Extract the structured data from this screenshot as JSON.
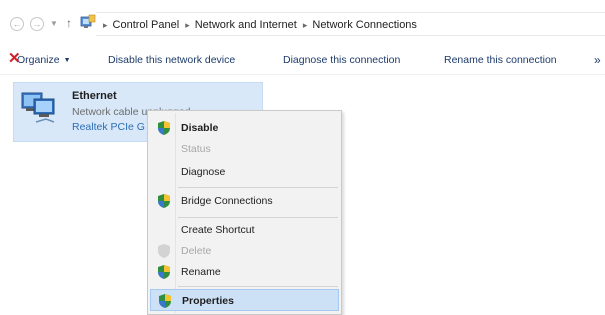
{
  "address_bar": {
    "breadcrumbs": [
      "Control Panel",
      "Network and Internet",
      "Network Connections"
    ]
  },
  "commands": [
    {
      "label": "Organize",
      "has_dropdown": true
    },
    {
      "label": "Disable this network device"
    },
    {
      "label": "Diagnose this connection"
    },
    {
      "label": "Rename this connection"
    }
  ],
  "connection": {
    "name": "Ethernet",
    "status": "Network cable unplugged",
    "adapter": "Realtek PCIe G"
  },
  "context_menu": {
    "items": [
      {
        "label": "Disable",
        "icon": "shield-icon",
        "bold": true
      },
      {
        "label": "Status",
        "disabled": true
      },
      {
        "label": "Diagnose"
      },
      {
        "label": "Bridge Connections",
        "icon": "shield-icon"
      },
      {
        "label": "Create Shortcut"
      },
      {
        "label": "Delete",
        "icon": "shield-icon",
        "disabled": true
      },
      {
        "label": "Rename",
        "icon": "shield-icon"
      },
      {
        "label": "Properties",
        "icon": "shield-icon",
        "selected": true
      }
    ]
  },
  "colors": {
    "selection": "#d8e8f9",
    "menu_highlight": "#cce0f6",
    "link_blue": "#2d6db5",
    "error_red": "#d0202a"
  }
}
